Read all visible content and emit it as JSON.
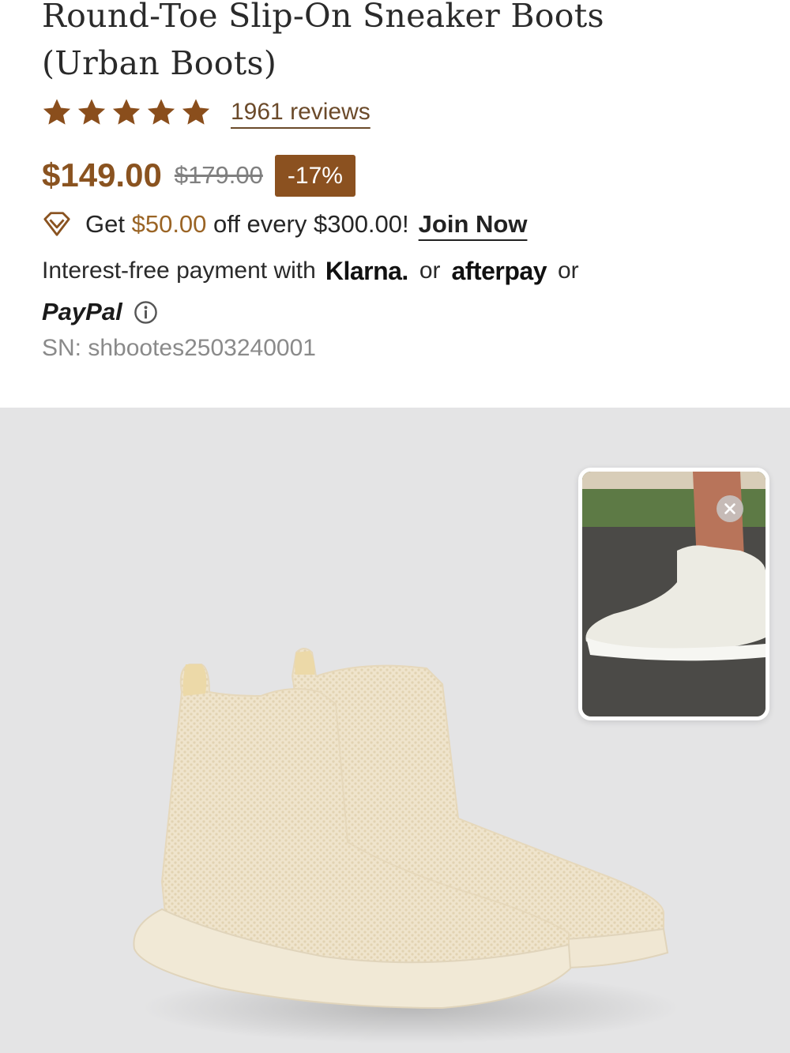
{
  "product": {
    "title_line1": "Round-Toe Slip-On Sneaker Boots",
    "title_line2": "(Urban Boots)",
    "rating_stars": 5,
    "reviews": "1961 reviews",
    "price": "$149.00",
    "old_price": "$179.00",
    "discount": "-17%",
    "sn": "SN: shbootes2503240001"
  },
  "promo": {
    "prefix": "Get ",
    "amount": "$50.00",
    "suffix": " off every $300.00!",
    "join_label": "Join Now"
  },
  "payment": {
    "text": "Interest-free payment with",
    "klarna": "Klarna.",
    "or1": "or",
    "afterpay": "afterpay",
    "or2": "or",
    "paypal": "PayPal"
  },
  "icons": {
    "star": "star-icon",
    "membership": "diamond-icon",
    "info": "info-icon",
    "close": "close-icon"
  },
  "colors": {
    "accent": "#8a5320",
    "badge": "#8b5120",
    "gold_text": "#9a6425",
    "gallery_bg": "#e4e4e5"
  }
}
